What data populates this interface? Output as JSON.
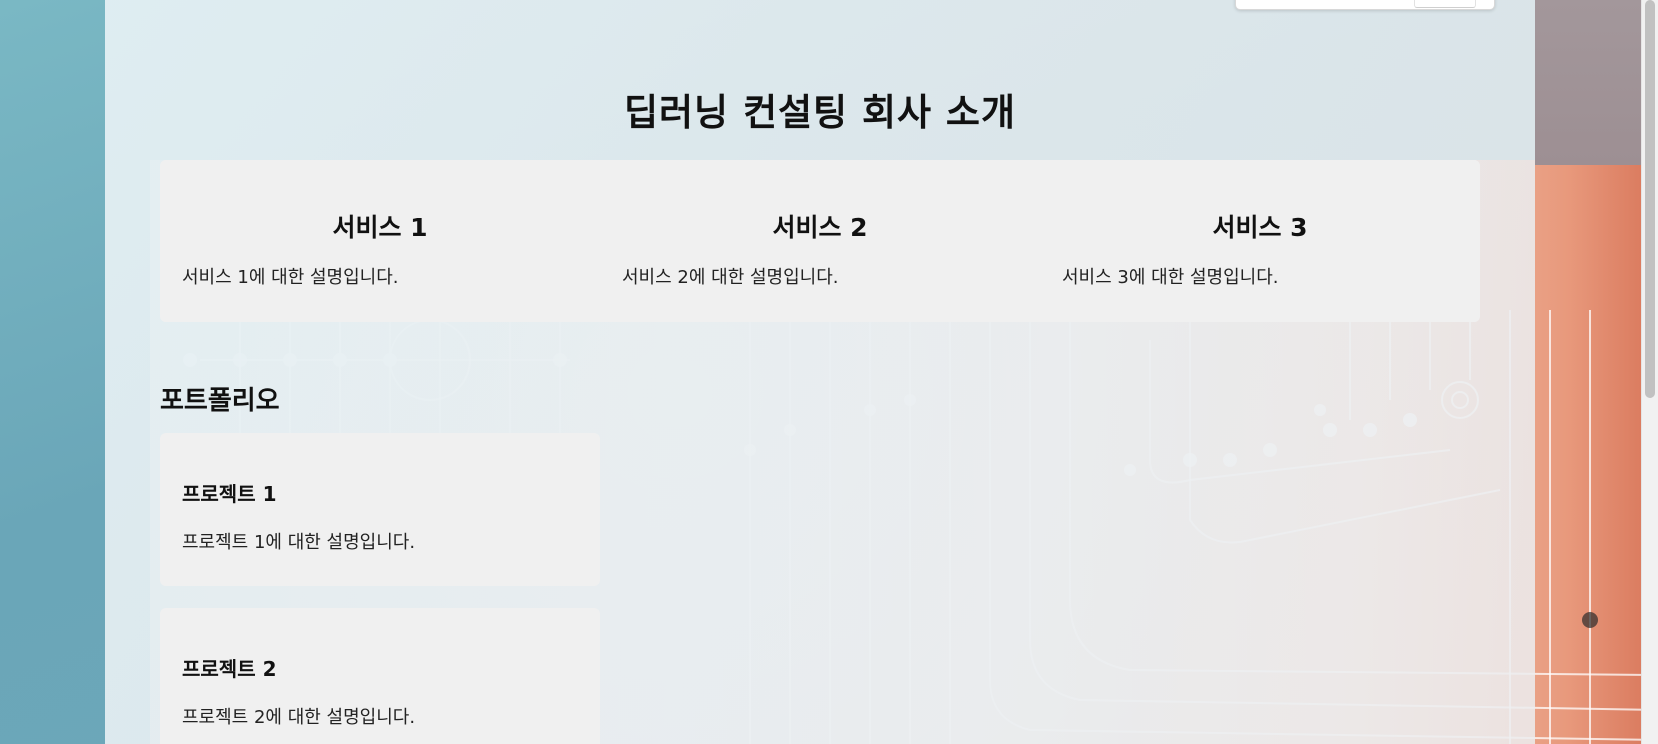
{
  "page": {
    "title": "딥러닝 컨설팅 회사 소개"
  },
  "services": [
    {
      "title": "서비스 1",
      "description": "서비스 1에 대한 설명입니다."
    },
    {
      "title": "서비스 2",
      "description": "서비스 2에 대한 설명입니다."
    },
    {
      "title": "서비스 3",
      "description": "서비스 3에 대한 설명입니다."
    }
  ],
  "portfolio": {
    "title": "포트폴리오",
    "projects": [
      {
        "title": "프로젝트 1",
        "description": "프로젝트 1에 대한 설명입니다."
      },
      {
        "title": "프로젝트 2",
        "description": "프로젝트 2에 대한 설명입니다."
      }
    ]
  },
  "colors": {
    "outer_background": "#6fa9bb",
    "card_background": "#f0f0f0",
    "accent_orange": "#e8997c"
  },
  "decoration": {
    "background_image": "circuit-board-pattern"
  }
}
